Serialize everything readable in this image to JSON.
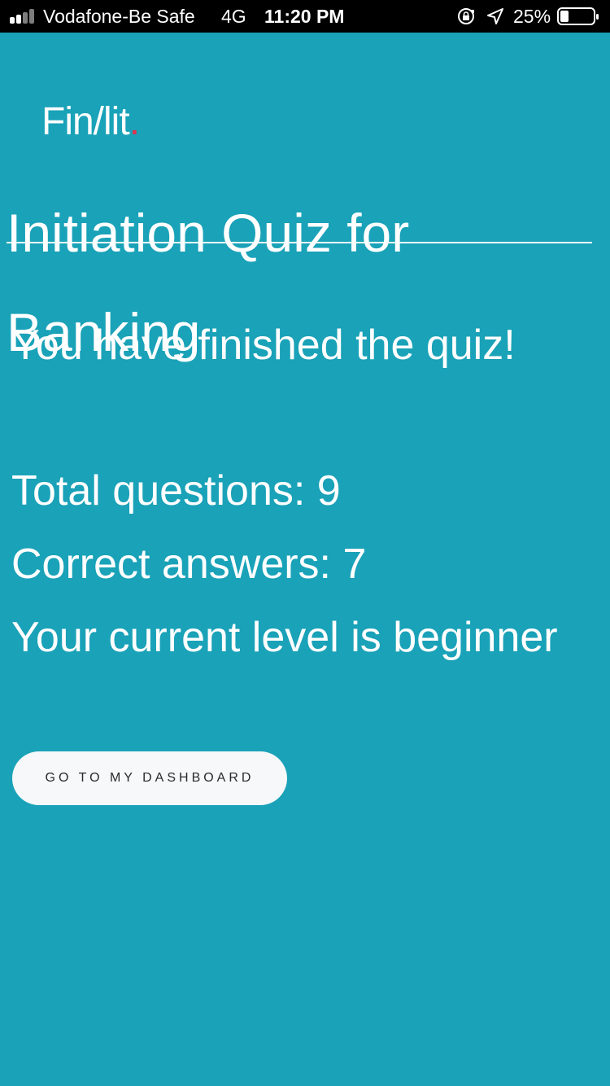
{
  "status_bar": {
    "carrier": "Vodafone-Be Safe",
    "network": "4G",
    "time": "11:20 PM",
    "battery_percent": "25%",
    "battery_level": 0.25,
    "signal_bars": 2,
    "signal_bars_total": 4
  },
  "app": {
    "logo_text": "Fin/lit",
    "logo_dot": ".",
    "logo_dot_color": "#e0334d",
    "background_color": "#19a2b8"
  },
  "quiz": {
    "title": "Initiation Quiz for Banking",
    "finished_message": "You have finished the quiz!",
    "total_questions_label": "Total questions: 9",
    "correct_answers_label": "Correct answers: 7",
    "level_label": "Your current level is beginner"
  },
  "actions": {
    "dashboard_button_label": "GO TO MY DASHBOARD"
  }
}
